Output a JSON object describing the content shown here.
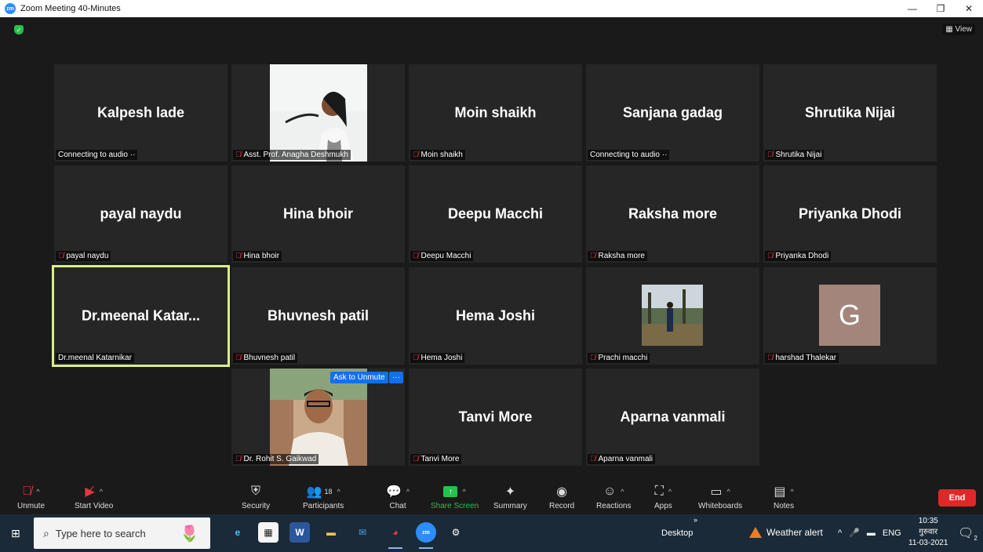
{
  "window": {
    "title": "Zoom Meeting 40-Minutes",
    "view_label": "View"
  },
  "tiles": [
    {
      "name": "Kalpesh lade",
      "label": "Connecting to audio ··",
      "muted": false
    },
    {
      "name": "",
      "label": "Asst. Prof. Anagha Deshmukh",
      "muted": true,
      "photo": "woman-speaker"
    },
    {
      "name": "Moin shaikh",
      "label": "Moin shaikh",
      "muted": true
    },
    {
      "name": "Sanjana gadag",
      "label": "Connecting to audio ··",
      "muted": false
    },
    {
      "name": "Shrutika Nijai",
      "label": "Shrutika Nijai",
      "muted": true
    },
    {
      "name": "payal naydu",
      "label": "payal naydu",
      "muted": true
    },
    {
      "name": "Hina bhoir",
      "label": "Hina bhoir",
      "muted": true
    },
    {
      "name": "Deepu Macchi",
      "label": "Deepu Macchi",
      "muted": true
    },
    {
      "name": "Raksha more",
      "label": "Raksha more",
      "muted": true
    },
    {
      "name": "Priyanka Dhodi",
      "label": "Priyanka Dhodi",
      "muted": true
    },
    {
      "name": "Dr.meenal  Katar...",
      "label": "Dr.meenal Katarnikar",
      "muted": false,
      "active": true
    },
    {
      "name": "Bhuvnesh patil",
      "label": "Bhuvnesh patil",
      "muted": true
    },
    {
      "name": "Hema Joshi",
      "label": "Hema Joshi",
      "muted": true
    },
    {
      "name": "",
      "label": "Prachi macchi",
      "muted": true,
      "photo": "landscape"
    },
    {
      "name": "",
      "label": "harshad Thalekar",
      "muted": true,
      "avatar": "G"
    },
    {
      "name": "",
      "label": "Dr. Rohit S. Gaikwad",
      "muted": true,
      "photo": "man",
      "ask_unmute": "Ask to Unmute",
      "more": "···"
    },
    {
      "name": "Tanvi More",
      "label": "Tanvi More",
      "muted": true
    },
    {
      "name": "Aparna vanmali",
      "label": "Aparna vanmali",
      "muted": true
    }
  ],
  "toolbar": {
    "unmute": "Unmute",
    "start_video": "Start Video",
    "security": "Security",
    "participants": "Participants",
    "participants_count": "18",
    "chat": "Chat",
    "share_screen": "Share Screen",
    "summary": "Summary",
    "record": "Record",
    "reactions": "Reactions",
    "apps": "Apps",
    "whiteboards": "Whiteboards",
    "notes": "Notes",
    "end": "End"
  },
  "taskbar": {
    "search_placeholder": "Type here to search",
    "desktop": "Desktop",
    "chevron": "»",
    "weather": "Weather alert",
    "lang": "ENG",
    "time": "10:35",
    "day": "गुरुवार",
    "date": "11-03-2021",
    "notif_count": "2"
  },
  "colors": {
    "accent": "#0e72ed",
    "share_green": "#27c24c",
    "end_red": "#e02828",
    "active_border": "#d9ef8a"
  }
}
